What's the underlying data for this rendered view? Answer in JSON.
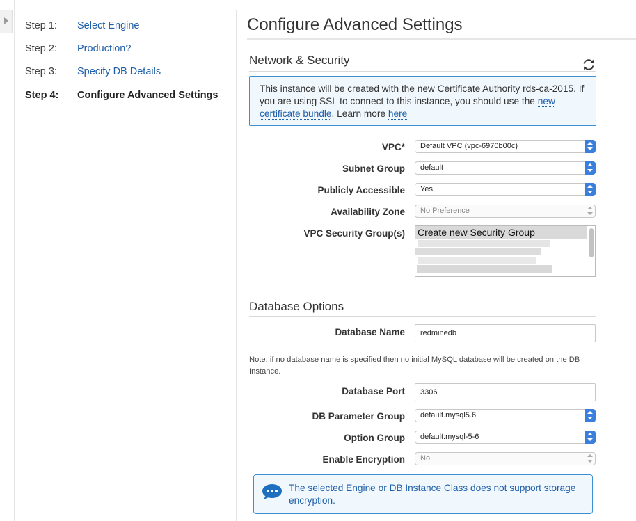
{
  "steps": [
    {
      "num": "Step 1:",
      "label": "Select Engine"
    },
    {
      "num": "Step 2:",
      "label": "Production?"
    },
    {
      "num": "Step 3:",
      "label": "Specify DB Details"
    },
    {
      "num": "Step 4:",
      "label": "Configure Advanced Settings"
    }
  ],
  "page_title": "Configure Advanced Settings",
  "network": {
    "title": "Network & Security",
    "info": {
      "text_before": "This instance will be created with the new Certificate Authority rds-ca-2015. If you are using SSL to connect to this instance, you should use the ",
      "link1": "new certificate bundle",
      "text_middle": ". Learn more ",
      "link2": "here"
    },
    "vpc_label": "VPC*",
    "vpc_value": "Default VPC (vpc-6970b00c)",
    "subnet_label": "Subnet Group",
    "subnet_value": "default",
    "public_label": "Publicly Accessible",
    "public_value": "Yes",
    "az_label": "Availability Zone",
    "az_value": "No Preference",
    "sg_label": "VPC Security Group(s)",
    "sg_option": "Create new Security Group"
  },
  "db": {
    "title": "Database Options",
    "name_label": "Database Name",
    "name_value": "redminedb",
    "note": "Note: if no database name is specified then no initial MySQL database will be created on the DB Instance.",
    "port_label": "Database Port",
    "port_value": "3306",
    "param_label": "DB Parameter Group",
    "param_value": "default.mysql5.6",
    "option_label": "Option Group",
    "option_value": "default:mysql-5-6",
    "enc_label": "Enable Encryption",
    "enc_value": "No",
    "warning": "The selected Engine or DB Instance Class does not support storage encryption."
  },
  "colors": {
    "accent": "#3b7fdd",
    "link": "#1f5fa8",
    "info_border": "#3d8ecf",
    "info_bg": "#f0f7fd"
  },
  "icons": {
    "refresh": "refresh-icon",
    "collapse": "chevron-right-icon",
    "info": "speech-bubble-icon"
  }
}
